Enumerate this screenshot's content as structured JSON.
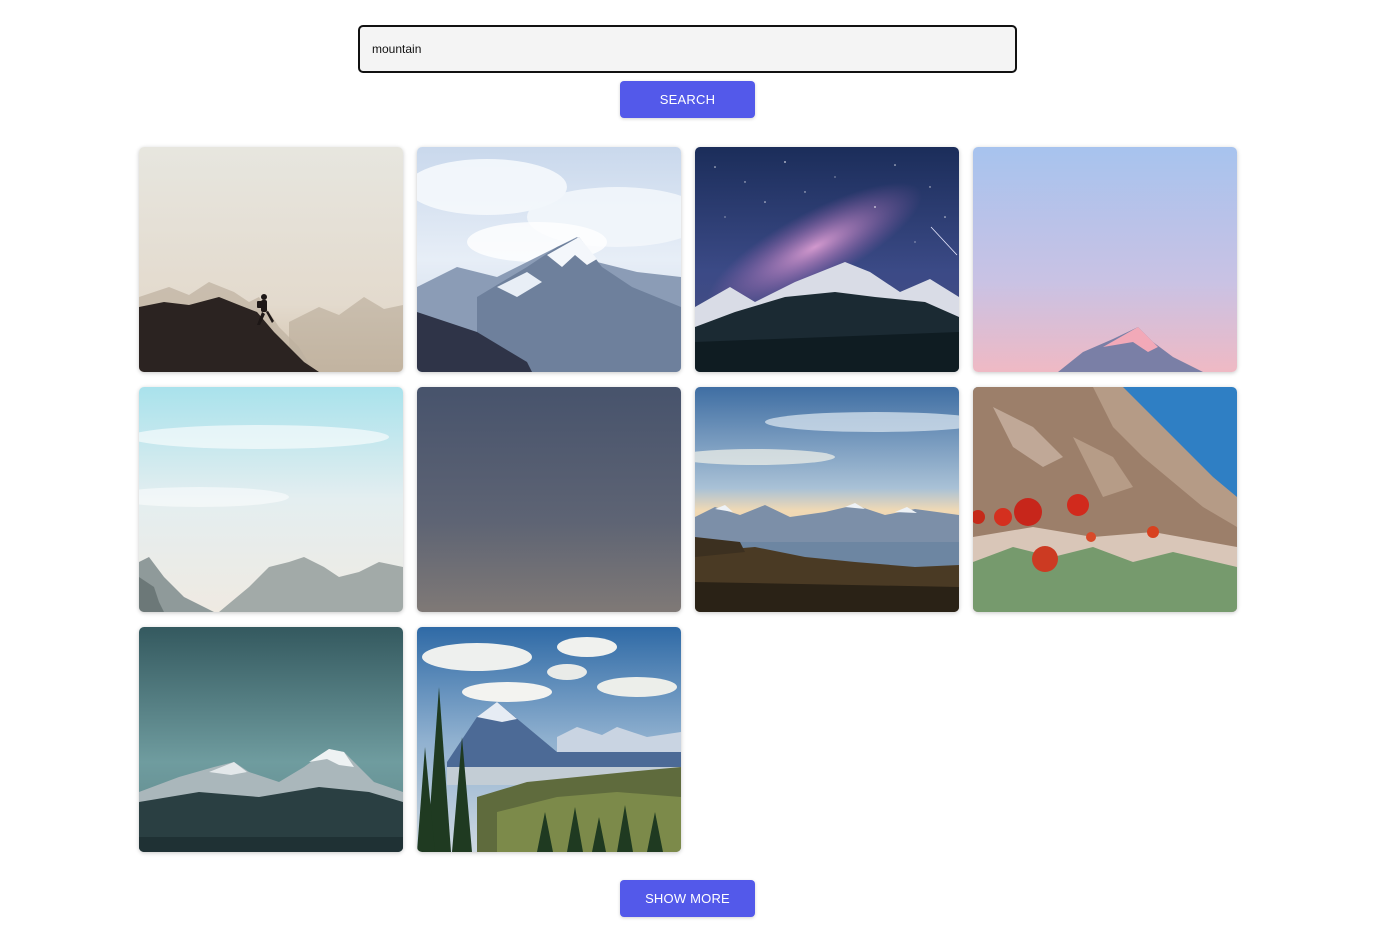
{
  "search": {
    "value": "mountain",
    "button_label": "SEARCH"
  },
  "gallery": {
    "photos": [
      {
        "scene": "hiker silhouette on misty ridge"
      },
      {
        "scene": "snowy peak under cloudy sky"
      },
      {
        "scene": "milky way over snowy mountains"
      },
      {
        "scene": "pink-lit peak under pastel sky"
      },
      {
        "scene": "hazy mountains under pale blue sky"
      },
      {
        "scene": "dusky grey gradient sky"
      },
      {
        "scene": "lake and snowy range at sunset"
      },
      {
        "scene": "red poppies below rocky cliff"
      },
      {
        "scene": "twin snowy peaks under teal sky"
      },
      {
        "scene": "valley with pine forest and mountains"
      }
    ]
  },
  "footer": {
    "show_more_label": "SHOW MORE"
  },
  "colors": {
    "accent": "#5359ea",
    "input_background": "#f4f4f4",
    "input_border": "#111111"
  }
}
